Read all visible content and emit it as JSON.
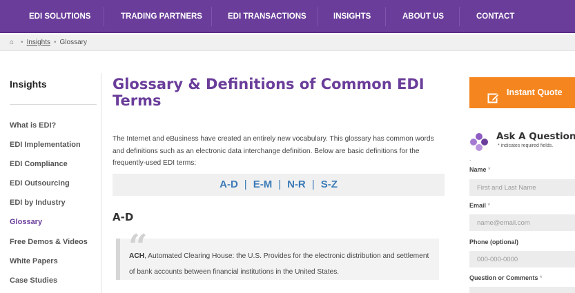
{
  "nav": {
    "items": [
      "EDI SOLUTIONS",
      "TRADING PARTNERS",
      "EDI TRANSACTIONS",
      "INSIGHTS",
      "ABOUT US",
      "CONTACT"
    ]
  },
  "breadcrumb": {
    "home_icon": "home-icon",
    "insights": "Insights",
    "current": "Glossary"
  },
  "sidebar": {
    "heading": "Insights",
    "items": [
      "What is EDI?",
      "EDI Implementation",
      "EDI Compliance",
      "EDI Outsourcing",
      "EDI by Industry",
      "Glossary",
      "Free Demos & Videos",
      "White Papers",
      "Case Studies"
    ],
    "active_item": "Glossary"
  },
  "main": {
    "title": "Glossary & Definitions of Common EDI Terms",
    "intro": "The Internet and eBusiness have created an entirely new vocabulary. This glossary has common words and definitions such as an electronic data interchange definition. Below are basic definitions for the frequently-used EDI terms:",
    "az_links": [
      "A-D",
      "E-M",
      "N-R",
      "S-Z"
    ],
    "az_separator": "|",
    "section_heading": "A-D",
    "quote_mark": "“",
    "entry": {
      "term": "ACH",
      "definition": ", Automated Clearing House: the U.S. Provides for the electronic distribution and settlement of bank accounts between financial institutions in the United States."
    }
  },
  "right": {
    "quote_button": "Instant Quote",
    "ask_title": "Ask A Question",
    "ask_sub": "* indicates required fields.",
    "dot": ".",
    "fields": [
      {
        "label": "Name",
        "req": " *",
        "placeholder": "First and Last Name"
      },
      {
        "label": "Email",
        "req": " *",
        "placeholder": "name@email.com"
      },
      {
        "label": "Phone (optional)",
        "req": "",
        "placeholder": "000-000-0000"
      },
      {
        "label": "Question or Comments",
        "req": " *",
        "placeholder": ""
      }
    ]
  },
  "colors": {
    "brand_purple": "#6a3d9a",
    "accent_orange": "#f5861f",
    "link_blue": "#3a7ab8"
  }
}
